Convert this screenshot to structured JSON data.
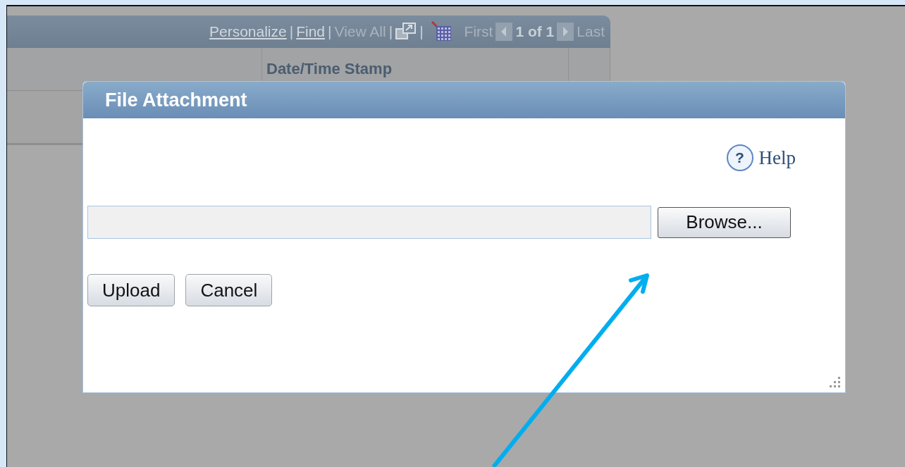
{
  "grid": {
    "toolbar": [
      {
        "kind": "link",
        "label": "Personalize",
        "disabled": false
      },
      {
        "kind": "separator",
        "label": "|"
      },
      {
        "kind": "link",
        "label": "Find",
        "disabled": false
      },
      {
        "kind": "separator",
        "label": "|"
      },
      {
        "kind": "link",
        "label": "View All",
        "disabled": true
      },
      {
        "kind": "separator",
        "label": "|"
      },
      {
        "kind": "popout"
      },
      {
        "kind": "separator",
        "label": "|"
      },
      {
        "kind": "export"
      },
      {
        "kind": "link",
        "label": "First",
        "disabled": true
      },
      {
        "kind": "prev"
      },
      {
        "kind": "counter",
        "label": "1 of 1"
      },
      {
        "kind": "next"
      },
      {
        "kind": "link",
        "label": "Last",
        "disabled": true
      }
    ],
    "date_column": "Date/Time Stamp"
  },
  "dialog": {
    "title": "File Attachment",
    "help_icon": "?",
    "help": "Help",
    "browse_button": "Browse...",
    "buttons": [
      "Upload",
      "Cancel"
    ]
  }
}
